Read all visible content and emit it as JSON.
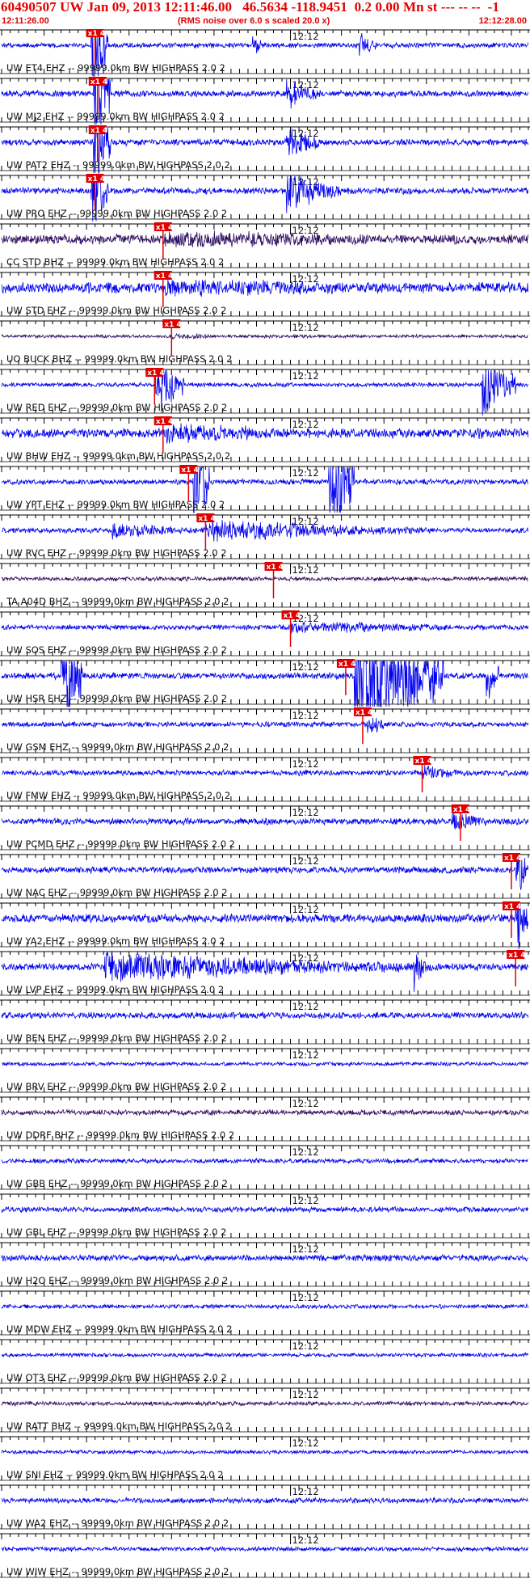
{
  "header": {
    "title": "60490507 UW Jan 09, 2013 12:11:46.00   46.5634 -118.9451  0.2 0.00 Mn st --- -- --  -1",
    "start_time": "12:11:26.00",
    "rms_note": "(RMS noise over 6.0 s scaled 20.0 x)",
    "end_time": "12:12:28.00"
  },
  "colors": {
    "header_text": "#e00000",
    "trace": "#0000ee",
    "trace_dark": "#2a0a5e",
    "pick": "#e00000",
    "grid": "#000000"
  },
  "chart_data": {
    "type": "line",
    "subtype": "seismogram record section",
    "time_axis": {
      "start": "12:11:26.00",
      "end": "12:12:28.00",
      "minute_mark": "12:12",
      "minute_mark_seconds": 34
    },
    "pick_label": "x1 4",
    "channels": [
      {
        "label": "UW ET4 EHZ -- 99999.0km BW  HIGHPASS  2.0  2",
        "pick_s": 11.0,
        "amp": 0.25,
        "dark": false,
        "bursts": [
          [
            10.5,
            12.5,
            7.0
          ],
          [
            29.5,
            31.0,
            1.2
          ],
          [
            42.0,
            44.0,
            1.6
          ]
        ]
      },
      {
        "label": "UW MJ2 EHZ -- 99999.0km BW  HIGHPASS  2.0  2",
        "pick_s": 11.3,
        "amp": 0.3,
        "dark": false,
        "bursts": [
          [
            10.8,
            12.8,
            7.0
          ],
          [
            33.5,
            37.5,
            1.5
          ]
        ]
      },
      {
        "label": "UW PAT2 EHZ -- 99999.0km BW  HIGHPASS  2.0  2",
        "pick_s": 11.3,
        "amp": 0.3,
        "dark": false,
        "bursts": [
          [
            10.8,
            12.8,
            7.0
          ],
          [
            33.5,
            37.5,
            1.8
          ]
        ]
      },
      {
        "label": "UW PRO EHZ -- 99999.0km BW  HIGHPASS  2.0  2",
        "pick_s": 11.0,
        "amp": 0.3,
        "dark": false,
        "bursts": [
          [
            10.5,
            12.5,
            6.0
          ],
          [
            33.5,
            40.0,
            2.0
          ]
        ]
      },
      {
        "label": "CC STD BHZ -- 99999.0km BW  HIGHPASS  2.0  2",
        "pick_s": 19.0,
        "amp": 0.45,
        "dark": true,
        "bursts": [
          [
            19.0,
            62.0,
            0.9
          ]
        ]
      },
      {
        "label": "UW STD EHZ -- 99999.0km BW  HIGHPASS  2.0  2",
        "pick_s": 19.0,
        "amp": 0.5,
        "dark": false,
        "bursts": [
          [
            19.0,
            62.0,
            0.9
          ]
        ]
      },
      {
        "label": "UO BUCK BHZ -- 99999.0km BW  HIGHPASS  2.0  2",
        "pick_s": 20.0,
        "amp": 0.15,
        "dark": true,
        "bursts": [
          [
            20.0,
            30.0,
            0.3
          ]
        ]
      },
      {
        "label": "UW RED EHZ -- 99999.0km BW  HIGHPASS  2.0  2",
        "pick_s": 18.0,
        "amp": 0.2,
        "dark": false,
        "bursts": [
          [
            18.0,
            21.5,
            3.0
          ],
          [
            56.5,
            60.5,
            3.0
          ]
        ]
      },
      {
        "label": "UW BHW EHZ -- 99999.0km BW  HIGHPASS  2.0  2",
        "pick_s": 19.0,
        "amp": 0.45,
        "dark": false,
        "bursts": [
          [
            19.0,
            42.0,
            1.0
          ],
          [
            56.0,
            57.0,
            1.0
          ]
        ]
      },
      {
        "label": "UW YPT EHZ -- 99999.0km BW  HIGHPASS  2.0  2",
        "pick_s": 22.0,
        "amp": 0.25,
        "dark": false,
        "bursts": [
          [
            22.5,
            24.5,
            7.0
          ],
          [
            38.5,
            41.5,
            7.0
          ]
        ]
      },
      {
        "label": "UW RVC EHZ -- 99999.0km BW  HIGHPASS  2.0  2",
        "pick_s": 24.0,
        "amp": 0.25,
        "dark": false,
        "bursts": [
          [
            13.0,
            24.0,
            0.8
          ],
          [
            24.0,
            50.0,
            1.1
          ]
        ]
      },
      {
        "label": "TA A04D BHZ -- 99999.0km BW  HIGHPASS  2.0  2",
        "pick_s": 32.0,
        "amp": 0.2,
        "dark": true,
        "bursts": []
      },
      {
        "label": "UW SOS EHZ -- 99999.0km BW  HIGHPASS  2.0  2",
        "pick_s": 34.0,
        "amp": 0.25,
        "dark": false,
        "bursts": [
          [
            34.0,
            62.0,
            0.6
          ]
        ]
      },
      {
        "label": "UW HSR EHZ -- 99999.0km BW  HIGHPASS  2.0  2",
        "pick_s": 40.5,
        "amp": 0.3,
        "dark": false,
        "bursts": [
          [
            7.0,
            9.5,
            7.0
          ],
          [
            41.5,
            52.0,
            7.0
          ],
          [
            57.0,
            58.5,
            3.0
          ]
        ]
      },
      {
        "label": "UW GSM EHZ -- 99999.0km BW  HIGHPASS  2.0  2",
        "pick_s": 42.5,
        "amp": 0.25,
        "dark": false,
        "bursts": [
          [
            43.0,
            45.0,
            1.5
          ]
        ]
      },
      {
        "label": "UW FMW EHZ -- 99999.0km BW  HIGHPASS  2.0  2",
        "pick_s": 49.5,
        "amp": 0.25,
        "dark": false,
        "bursts": [
          [
            49.5,
            56.0,
            0.8
          ]
        ]
      },
      {
        "label": "UW PCMD EHZ -- 99999.0km BW  HIGHPASS  2.0  2",
        "pick_s": 54.0,
        "amp": 0.3,
        "dark": false,
        "bursts": [
          [
            53.0,
            57.0,
            1.2
          ]
        ]
      },
      {
        "label": "UW NAC EHZ -- 99999.0km BW  HIGHPASS  2.0  2",
        "pick_s": 60.0,
        "amp": 0.3,
        "dark": false,
        "bursts": [
          [
            60.5,
            62.0,
            4.0
          ]
        ]
      },
      {
        "label": "UW YA2 EHZ -- 99999.0km BW  HIGHPASS  2.0  2",
        "pick_s": 60.0,
        "amp": 0.4,
        "dark": false,
        "bursts": [
          [
            60.5,
            62.0,
            4.0
          ]
        ]
      },
      {
        "label": "UW LVP EHZ -- 99999.0km BW  HIGHPASS  2.0  2",
        "pick_s": 60.5,
        "amp": 0.35,
        "dark": false,
        "bursts": [
          [
            12.0,
            50.0,
            1.4
          ],
          [
            48.5,
            50.0,
            2.2
          ]
        ]
      },
      {
        "label": "UW BEN EHZ -- 99999.0km BW  HIGHPASS  2.0  2",
        "pick_s": null,
        "amp": 0.3,
        "dark": false,
        "bursts": []
      },
      {
        "label": "UW BRV EHZ -- 99999.0km BW  HIGHPASS  2.0  2",
        "pick_s": null,
        "amp": 0.18,
        "dark": false,
        "bursts": []
      },
      {
        "label": "UW DDRF BHZ -- 99999.0km BW  HIGHPASS  2.0  2",
        "pick_s": null,
        "amp": 0.25,
        "dark": true,
        "bursts": []
      },
      {
        "label": "UW GBB EHZ -- 99999.0km BW  HIGHPASS  2.0  2",
        "pick_s": null,
        "amp": 0.22,
        "dark": false,
        "bursts": []
      },
      {
        "label": "UW GBL EHZ -- 99999.0km BW  HIGHPASS  2.0  2",
        "pick_s": null,
        "amp": 0.25,
        "dark": false,
        "bursts": []
      },
      {
        "label": "UW H2O EHZ -- 99999.0km BW  HIGHPASS  2.0  2",
        "pick_s": null,
        "amp": 0.3,
        "dark": false,
        "bursts": []
      },
      {
        "label": "UW MDW EHZ -- 99999.0km BW  HIGHPASS  2.0  2",
        "pick_s": null,
        "amp": 0.2,
        "dark": false,
        "bursts": []
      },
      {
        "label": "UW OT3 EHZ -- 99999.0km BW  HIGHPASS  2.0  2",
        "pick_s": null,
        "amp": 0.18,
        "dark": false,
        "bursts": []
      },
      {
        "label": "UW RATT BHZ -- 99999.0km BW  HIGHPASS  2.0  2",
        "pick_s": null,
        "amp": 0.2,
        "dark": true,
        "bursts": []
      },
      {
        "label": "UW SNI EHZ -- 99999.0km BW  HIGHPASS  2.0  2",
        "pick_s": null,
        "amp": 0.18,
        "dark": false,
        "bursts": []
      },
      {
        "label": "UW WA2 EHZ -- 99999.0km BW  HIGHPASS  2.0  2",
        "pick_s": null,
        "amp": 0.25,
        "dark": false,
        "bursts": []
      },
      {
        "label": "UW WIW EHZ -- 99999.0km BW  HIGHPASS  2.0  2",
        "pick_s": null,
        "amp": 0.2,
        "dark": false,
        "bursts": []
      }
    ]
  }
}
